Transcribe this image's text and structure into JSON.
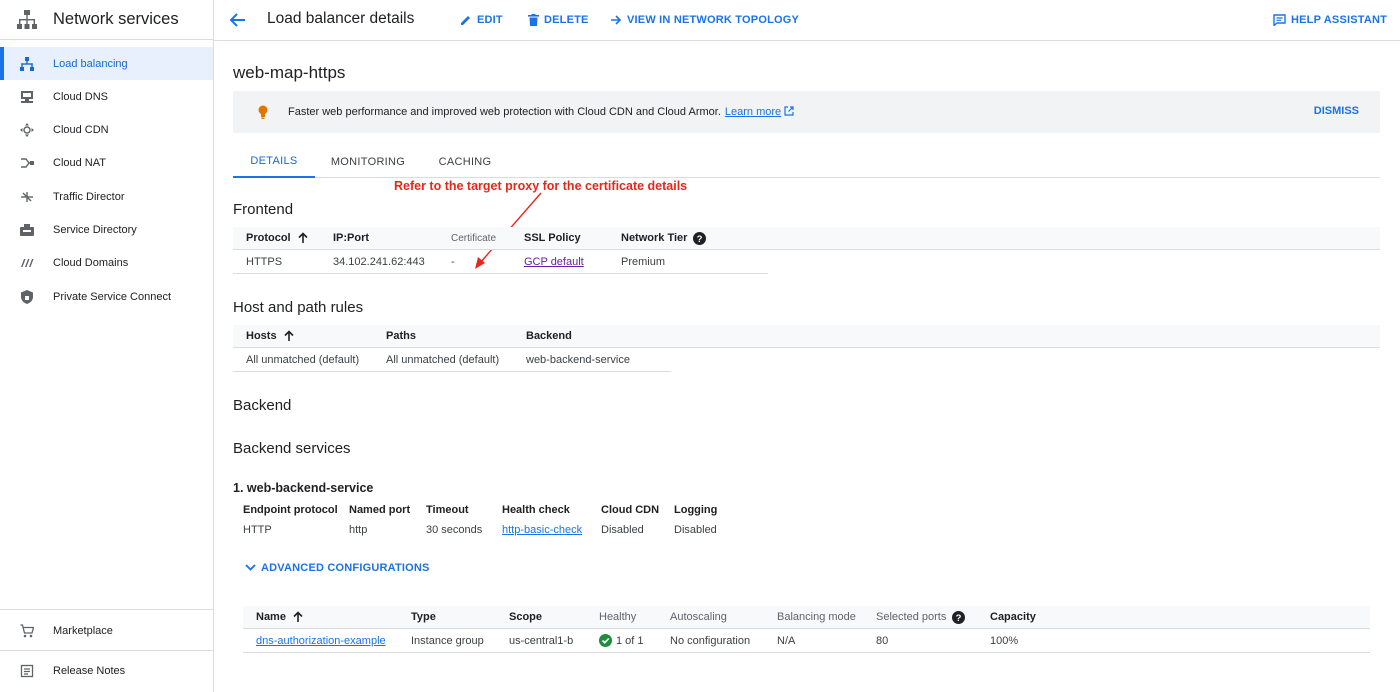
{
  "sidebar": {
    "title": "Network services",
    "items": [
      {
        "label": "Load balancing",
        "icon": "load-balancing-icon"
      },
      {
        "label": "Cloud DNS",
        "icon": "dns-icon"
      },
      {
        "label": "Cloud CDN",
        "icon": "cdn-icon"
      },
      {
        "label": "Cloud NAT",
        "icon": "nat-icon"
      },
      {
        "label": "Traffic Director",
        "icon": "traffic-director-icon"
      },
      {
        "label": "Service Directory",
        "icon": "service-directory-icon"
      },
      {
        "label": "Cloud Domains",
        "icon": "domains-icon"
      },
      {
        "label": "Private Service Connect",
        "icon": "shield-icon"
      }
    ],
    "footer": [
      {
        "label": "Marketplace",
        "icon": "cart-icon"
      },
      {
        "label": "Release Notes",
        "icon": "notes-icon"
      }
    ]
  },
  "topbar": {
    "title": "Load balancer details",
    "edit": "EDIT",
    "delete": "DELETE",
    "topology": "VIEW IN NETWORK TOPOLOGY",
    "help": "HELP ASSISTANT"
  },
  "main": {
    "lb_name": "web-map-https",
    "banner": {
      "message": "Faster web performance and improved web protection with Cloud CDN and Cloud Armor.",
      "link": "Learn more",
      "dismiss": "DISMISS"
    },
    "tabs": [
      "DETAILS",
      "MONITORING",
      "CACHING"
    ],
    "annotation": "Refer to the target proxy for the certificate details",
    "frontend": {
      "heading": "Frontend",
      "headers": [
        "Protocol",
        "IP:Port",
        "Certificate",
        "SSL Policy",
        "Network Tier"
      ],
      "row": [
        "HTTPS",
        "34.102.241.62:443",
        "-",
        "GCP default",
        "Premium"
      ]
    },
    "host_rules": {
      "heading": "Host and path rules",
      "headers": [
        "Hosts",
        "Paths",
        "Backend"
      ],
      "row": [
        "All unmatched (default)",
        "All unmatched (default)",
        "web-backend-service"
      ]
    },
    "backend": {
      "heading": "Backend",
      "services_heading": "Backend services",
      "service_title": "1. web-backend-service",
      "props": [
        {
          "k": "Endpoint protocol",
          "v": "HTTP"
        },
        {
          "k": "Named port",
          "v": "http"
        },
        {
          "k": "Timeout",
          "v": "30 seconds"
        },
        {
          "k": "Health check",
          "v": "http-basic-check"
        },
        {
          "k": "Cloud CDN",
          "v": "Disabled"
        },
        {
          "k": "Logging",
          "v": "Disabled"
        }
      ],
      "advanced": "ADVANCED CONFIGURATIONS",
      "table": {
        "headers": [
          "Name",
          "Type",
          "Scope",
          "Healthy",
          "Autoscaling",
          "Balancing mode",
          "Selected ports",
          "Capacity"
        ],
        "row": [
          "dns-authorization-example",
          "Instance group",
          "us-central1-b",
          "1 of 1",
          "No configuration",
          "N/A",
          "80",
          "100%"
        ]
      }
    }
  },
  "colors": {
    "accent": "#1a73e8",
    "annotation": "#e8271c",
    "healthy": "#1e8e3e"
  }
}
